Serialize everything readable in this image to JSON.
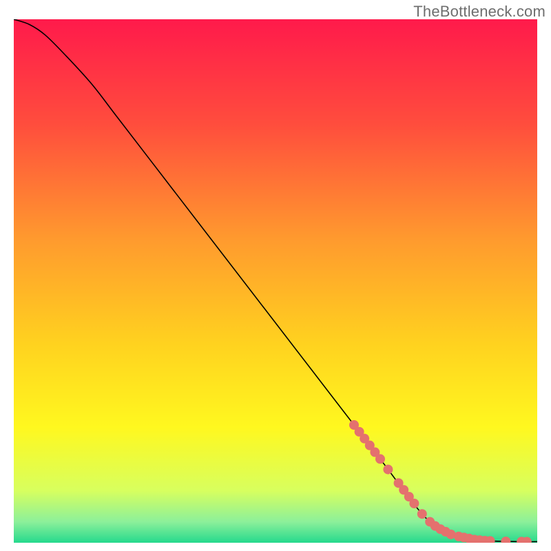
{
  "watermark": "TheBottleneck.com",
  "colors": {
    "curve": "#000000",
    "marker_fill": "#e4716e",
    "marker_stroke": "#c85a57"
  },
  "chart_data": {
    "type": "line",
    "title": "",
    "xlabel": "",
    "ylabel": "",
    "xlim": [
      0,
      100
    ],
    "ylim": [
      0,
      100
    ],
    "grid": false,
    "legend": null,
    "background_gradient": {
      "direction": "vertical",
      "stops": [
        {
          "pos": 0.0,
          "color": "#ff1a4b"
        },
        {
          "pos": 0.2,
          "color": "#ff4d3d"
        },
        {
          "pos": 0.42,
          "color": "#ff9a2e"
        },
        {
          "pos": 0.62,
          "color": "#ffd21f"
        },
        {
          "pos": 0.78,
          "color": "#fff81f"
        },
        {
          "pos": 0.9,
          "color": "#d8ff5e"
        },
        {
          "pos": 0.96,
          "color": "#8cf09a"
        },
        {
          "pos": 1.0,
          "color": "#25d98d"
        }
      ]
    },
    "series": [
      {
        "name": "curve",
        "x": [
          0,
          3,
          6,
          10,
          15,
          20,
          30,
          40,
          50,
          60,
          70,
          78,
          82,
          85,
          88,
          90,
          92,
          94,
          96,
          98,
          100
        ],
        "y": [
          100,
          99,
          97,
          93,
          87.5,
          81,
          68,
          55,
          42,
          29,
          16,
          5.5,
          2.5,
          1.2,
          0.6,
          0.4,
          0.3,
          0.25,
          0.22,
          0.2,
          0.2
        ]
      }
    ],
    "markers": [
      {
        "x": 65.0,
        "y": 22.5
      },
      {
        "x": 66.0,
        "y": 21.2
      },
      {
        "x": 67.0,
        "y": 19.9
      },
      {
        "x": 68.0,
        "y": 18.6
      },
      {
        "x": 69.0,
        "y": 17.3
      },
      {
        "x": 70.0,
        "y": 16.0
      },
      {
        "x": 71.5,
        "y": 14.0
      },
      {
        "x": 73.5,
        "y": 11.4
      },
      {
        "x": 74.5,
        "y": 10.1
      },
      {
        "x": 75.5,
        "y": 8.8
      },
      {
        "x": 76.5,
        "y": 7.5
      },
      {
        "x": 78.0,
        "y": 5.5
      },
      {
        "x": 79.5,
        "y": 4.0
      },
      {
        "x": 80.5,
        "y": 3.2
      },
      {
        "x": 81.5,
        "y": 2.6
      },
      {
        "x": 82.5,
        "y": 2.1
      },
      {
        "x": 83.5,
        "y": 1.6
      },
      {
        "x": 85.0,
        "y": 1.2
      },
      {
        "x": 86.0,
        "y": 1.0
      },
      {
        "x": 87.0,
        "y": 0.8
      },
      {
        "x": 88.0,
        "y": 0.6
      },
      {
        "x": 89.0,
        "y": 0.5
      },
      {
        "x": 90.0,
        "y": 0.4
      },
      {
        "x": 91.0,
        "y": 0.35
      },
      {
        "x": 94.0,
        "y": 0.25
      },
      {
        "x": 97.0,
        "y": 0.22
      },
      {
        "x": 98.0,
        "y": 0.2
      }
    ],
    "marker_radius_px": 7
  }
}
